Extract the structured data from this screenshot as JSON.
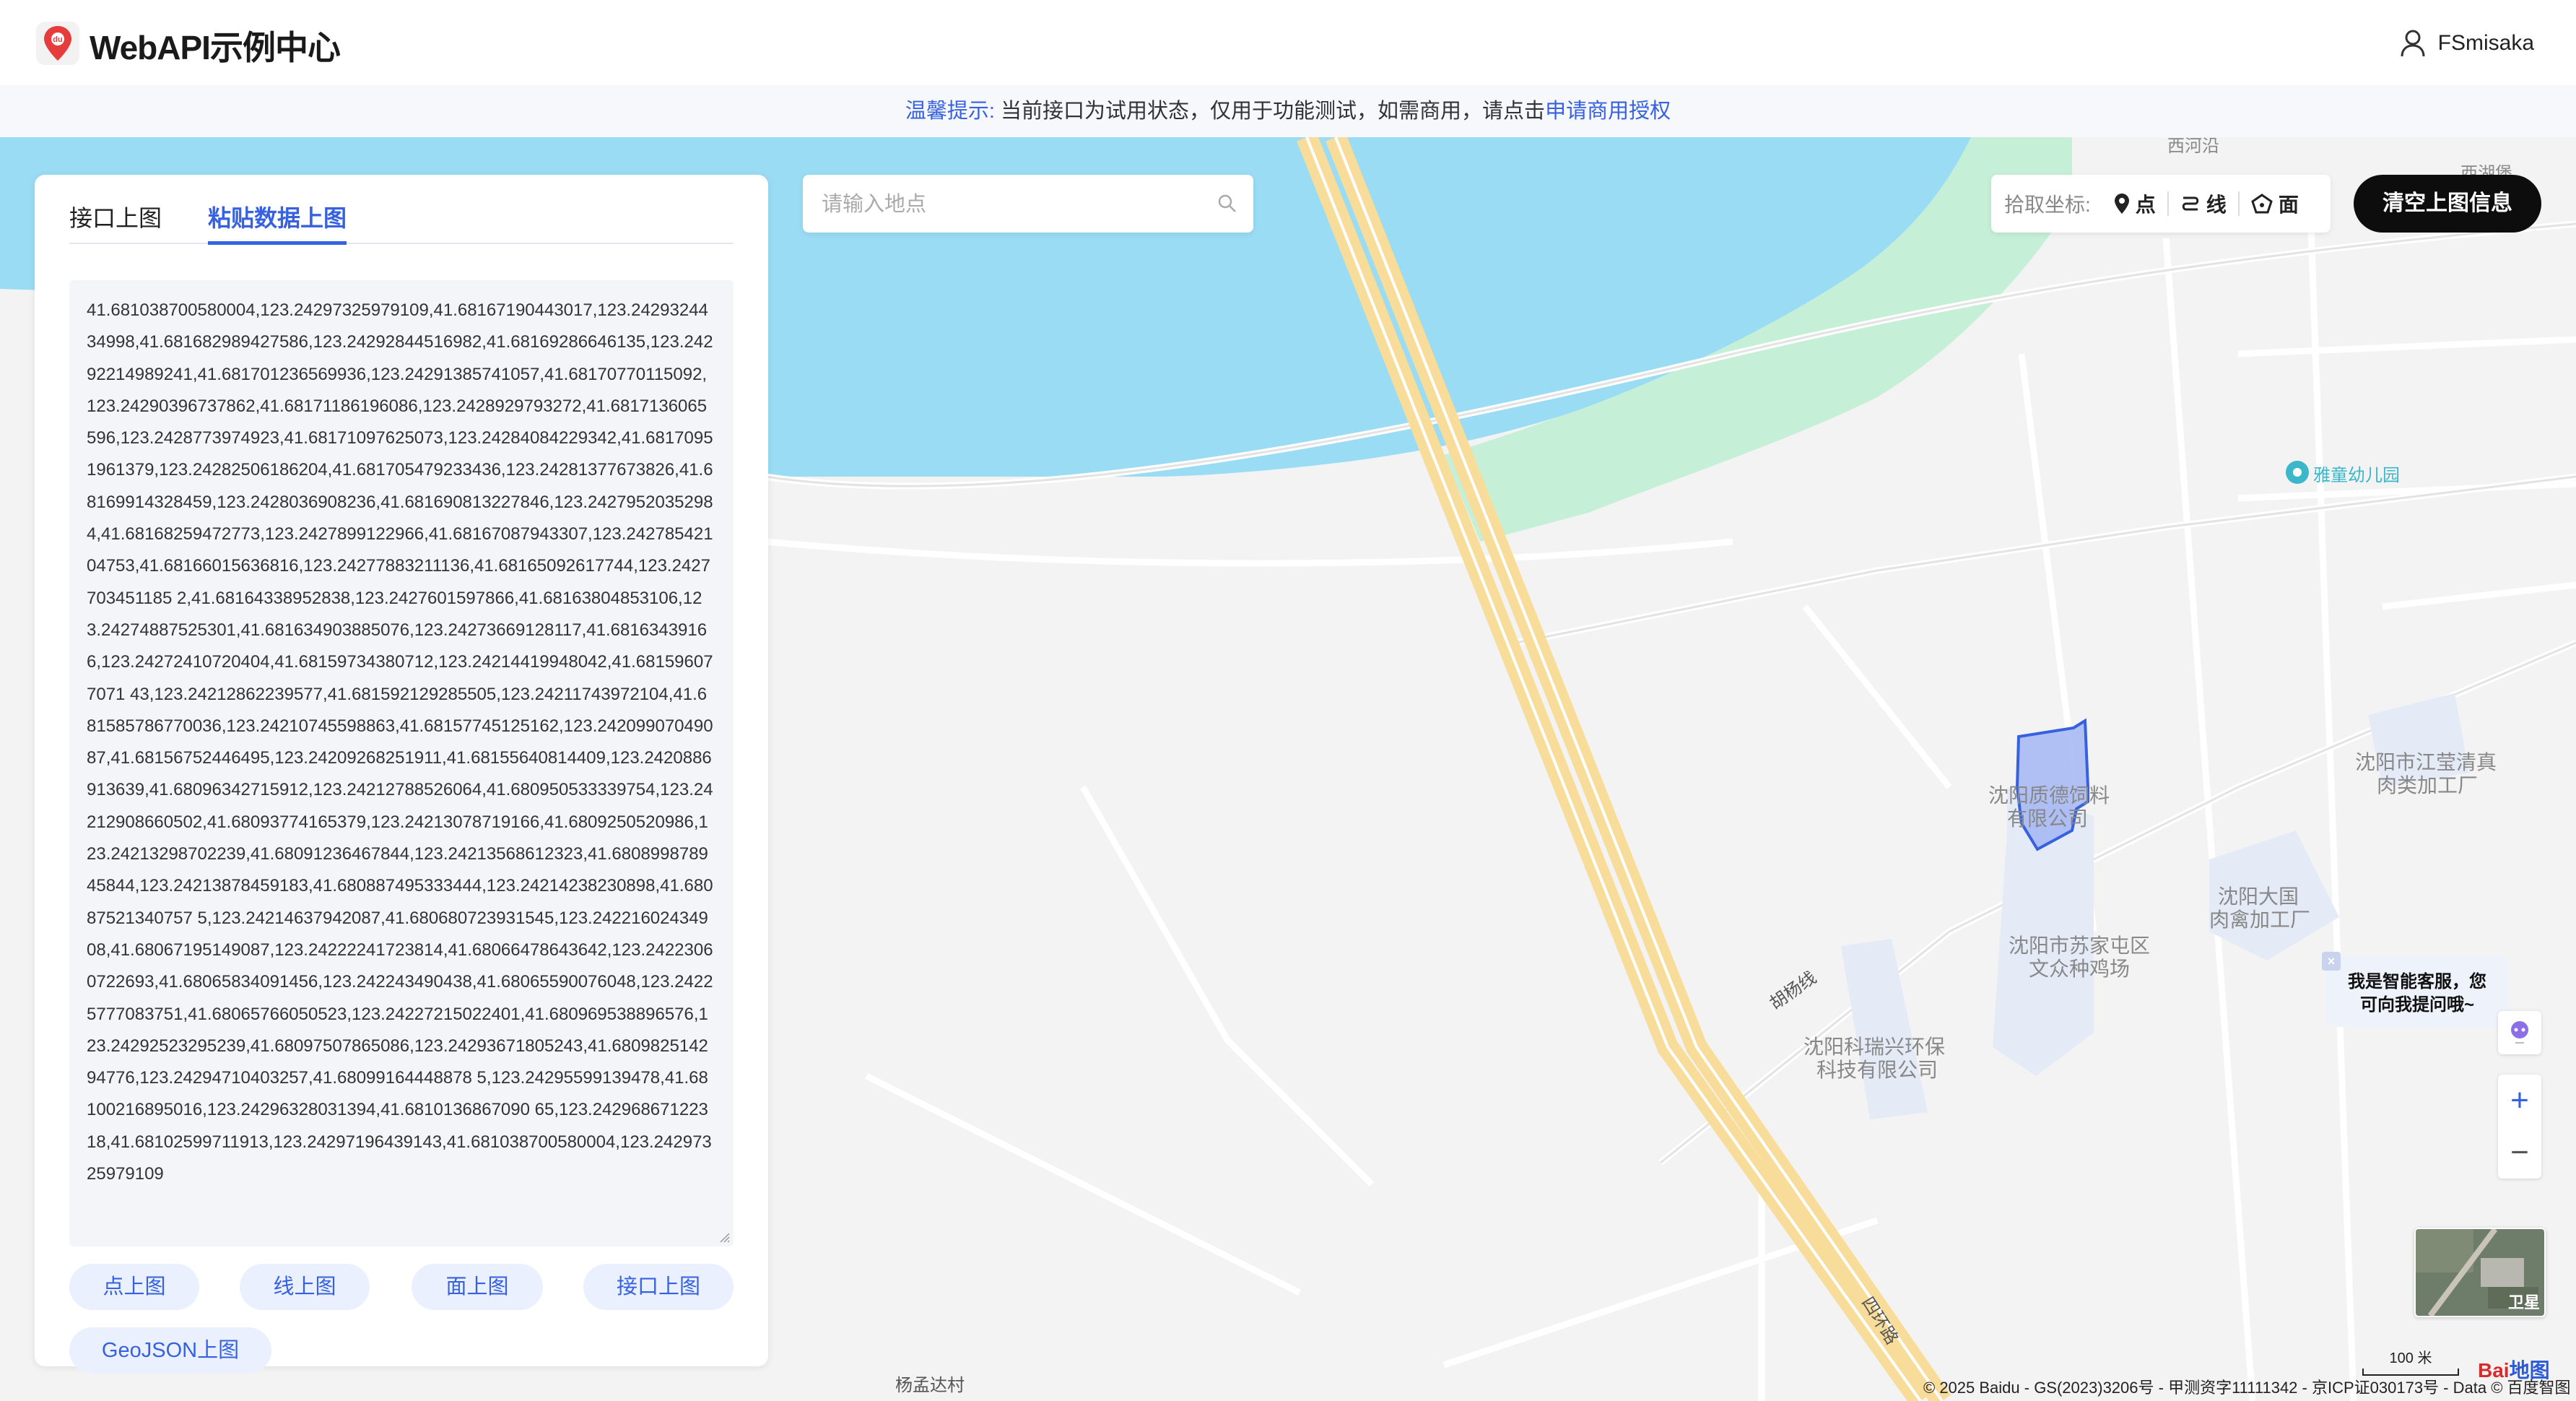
{
  "header": {
    "app_title": "WebAPI示例中心",
    "username": "FSmisaka"
  },
  "notice": {
    "prefix": "温馨提示:",
    "message": "当前接口为试用状态，仅用于功能测试，如需商用，请点击",
    "link": "申请商用授权"
  },
  "panel": {
    "tabs": [
      "接口上图",
      "粘贴数据上图"
    ],
    "active_tab": "粘贴数据上图",
    "textarea_value": "41.681038700580004,123.24297325979109,41.68167190443017,123.2429324434998,41.681682989427586,123.24292844516982,41.68169286646135,123.24292214989241,41.681701236569936,123.24291385741057,41.68170770115092,123.24290396737862,41.68171186196086,123.2428929793272,41.6817136065596,123.2428773974923,41.68171097625073,123.24284084229342,41.68170951961379,123.24282506186204,41.681705479233436,123.24281377673826,41.68169914328459,123.2428036908236,41.681690813227846,123.24279520352984,41.68168259472773,123.2427899122966,41.68167087943307,123.24278542104753,41.68166015636816,123.24277883211136,41.68165092617744,123.2427703451185 2,41.68164338952838,123.2427601597866,41.68163804853106,123.24274887525301,41.681634903885076,123.24273669128117,41.68163439166,123.24272410720404,41.68159734380712,123.24214419948042,41.681596077071 43,123.24212862239577,41.681592129285505,123.24211743972104,41.681585786770036,123.24210745598863,41.68157745125162,123.24209907049087,41.68156752446495,123.24209268251911,41.68155640814409,123.2420886913639,41.68096342715912,123.24212788526064,41.680950533339754,123.24212908660502,41.68093774165379,123.24213078719166,41.6809250520986,123.24213298702239,41.68091236467844,123.24213568612323,41.680899878945844,123.24213878459183,41.680887495333444,123.24214238230898,41.68087521340757 5,123.24214637942087,41.680680723931545,123.24221602434908,41.68067195149087,123.24222241723814,41.68066478643642,123.24223060722693,41.68065834091456,123.242243490438,41.68065590076048,123.24225777083751,41.68065766050523,123.24227215022401,41.680969538896576,123.24292523295239,41.68097507865086,123.24293671805243,41.680982514294776,123.24294710403257,41.68099164448878 5,123.24295599139478,41.68100216895016,123.24296328031394,41.6810136867090 65,123.24296867122318,41.68102599711913,123.24297196439143,41.681038700580004,123.24297325979109",
    "buttons": {
      "point": "点上图",
      "line": "线上图",
      "polygon": "面上图",
      "api": "接口上图",
      "geojson": "GeoJSON上图"
    }
  },
  "search": {
    "placeholder": "请输入地点"
  },
  "pick_toolbar": {
    "label": "拾取坐标:",
    "point": "点",
    "line": "线",
    "polygon": "面"
  },
  "clear_button": "清空上图信息",
  "ai_assistant": {
    "line1": "我是智能客服，您",
    "line2": "可向我提问哦~"
  },
  "map": {
    "labels": {
      "xihe": "西河沿",
      "xihu": "西湖堡",
      "kindergarten": "雅童幼儿园",
      "company1a": "沈阳质德饲料",
      "company1b": "有限公司",
      "company2a": "沈阳市江莹清真",
      "company2b": "肉类加工厂",
      "company3a": "沈阳大国",
      "company3b": "肉禽加工厂",
      "company4a": "沈阳市苏家屯区",
      "company4b": "文众种鸡场",
      "company5a": "沈阳科瑞兴环保",
      "company5b": "科技有限公司",
      "road1": "胡杨线",
      "road2": "四环路",
      "village": "杨孟达村"
    },
    "satellite_label": "卫星",
    "scale": "100 米",
    "copyright": "© 2025 Baidu - GS(2023)3206号 - 甲测资字11111342 - 京ICP证030173号 - Data © 百度智图",
    "logo_text_a": "Bai",
    "logo_text_b": "地图"
  },
  "colors": {
    "accent": "#3661e0",
    "water": "#99dcf4",
    "green": "#c5efd7",
    "highway": "#f8dc9a",
    "polygon_fill": "#a3b6f3",
    "polygon_stroke": "#3661e0"
  }
}
